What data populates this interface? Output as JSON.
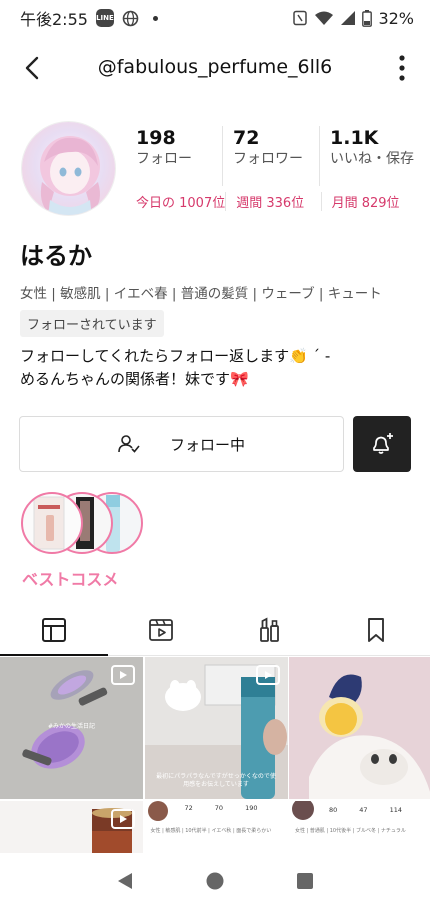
{
  "status_bar": {
    "time": "午後2:55",
    "line_label": "LINE",
    "battery": "32%"
  },
  "header": {
    "title": "@fabulous_perfume_6ll6"
  },
  "stats": [
    {
      "value": "198",
      "label": "フォロー"
    },
    {
      "value": "72",
      "label": "フォロワー"
    },
    {
      "value": "1.1K",
      "label": "いいね・保存"
    }
  ],
  "ranks": {
    "today": "今日の 1007位",
    "weekly": "週間 336位",
    "monthly": "月間 829位"
  },
  "profile": {
    "name": "はるか",
    "tags": "女性 | 敏感肌 | イエベ春 | 普通の髪質 | ウェーブ | キュート",
    "follows_you": "フォローされています",
    "bio_line1": "フォローしてくれたらフォロー返します👏 ´ -",
    "bio_line2": "めるんちゃんの関係者！妹です🎀"
  },
  "actions": {
    "follow_label": "フォロー中"
  },
  "best_cosme": {
    "label": "ベストコスメ"
  },
  "tabs": [
    {
      "name": "grid-icon",
      "active": true
    },
    {
      "name": "video-icon",
      "active": false
    },
    {
      "name": "cosmetics-icon",
      "active": false
    },
    {
      "name": "bookmark-icon",
      "active": false
    }
  ],
  "grid": {
    "post1_caption": "#みかの生活日記",
    "post2_caption": "最初にパラパラなんですがせっかくなので使用感をお伝えしています",
    "post5_stats": [
      "72",
      "70",
      "190"
    ],
    "post6_stats": [
      "80",
      "47",
      "114"
    ],
    "post5_tags": "女性 | 敏感肌 | 10代前半 | イエベ秋 | 面長で柔らかい",
    "post6_tags": "女性 | 普通肌 | 10代後半 | ブルベ冬 | ナチュラル"
  },
  "colors": {
    "accent_pink": "#d6396b",
    "cosme_pink": "#f07aa6"
  }
}
